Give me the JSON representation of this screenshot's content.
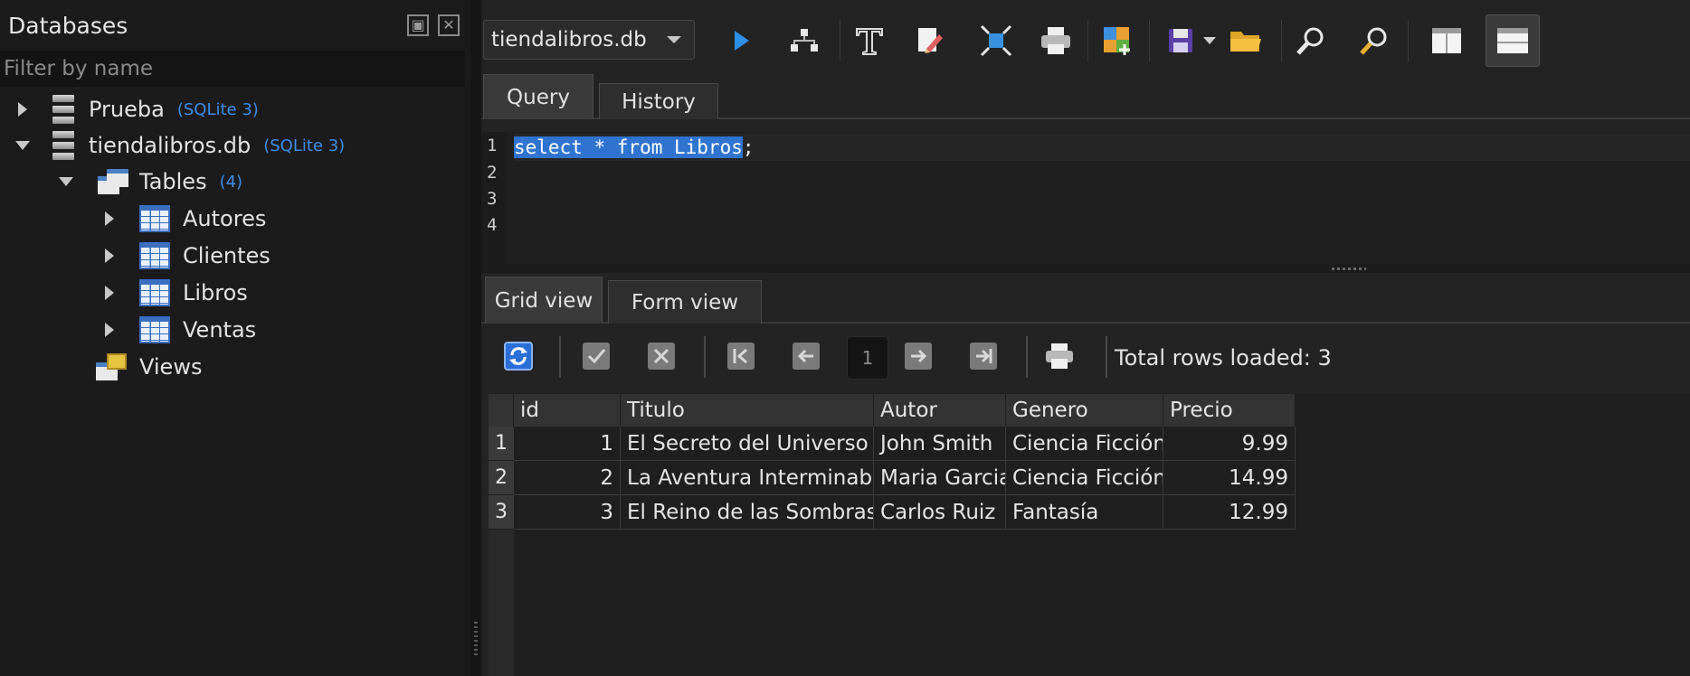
{
  "databases_panel": {
    "title": "Databases",
    "filter_placeholder": "Filter by name",
    "tree": {
      "prueba": {
        "label": "Prueba",
        "meta": "(SQLite 3)"
      },
      "tiendalibros": {
        "label": "tiendalibros.db",
        "meta": "(SQLite 3)"
      },
      "tables": {
        "label": "Tables",
        "count": "(4)"
      },
      "table_items": [
        "Autores",
        "Clientes",
        "Libros",
        "Ventas"
      ],
      "views": {
        "label": "Views"
      }
    }
  },
  "toolbar": {
    "db_selector": "tiendalibros.db",
    "icons": [
      "execute-icon",
      "explain-plan-icon",
      "format-text-icon",
      "clear-icon",
      "fit-icon",
      "print-icon",
      "import-icon",
      "save-icon",
      "save-dropdown-icon",
      "open-folder-icon",
      "zoom-in-icon",
      "zoom-out-icon",
      "layout-vertical-icon",
      "layout-horizontal-icon"
    ]
  },
  "query_tabs": {
    "query": "Query",
    "history": "History"
  },
  "editor": {
    "line_numbers": [
      "1",
      "2",
      "3",
      "4"
    ],
    "selected_sql": "select * from Libros",
    "trailing": ";"
  },
  "result_tabs": {
    "grid": "Grid view",
    "form": "Form view"
  },
  "result_toolbar": {
    "page": "1",
    "total_rows": "Total rows loaded: 3"
  },
  "grid": {
    "columns": [
      "id",
      "Titulo",
      "Autor",
      "Genero",
      "Precio"
    ],
    "rows": [
      {
        "n": "1",
        "id": "1",
        "titulo": "El Secreto del Universo",
        "autor": "John Smith",
        "genero": "Ciencia Ficción",
        "precio": "9.99"
      },
      {
        "n": "2",
        "id": "2",
        "titulo": "La Aventura Interminable",
        "autor": "Maria Garcia",
        "genero": "Ciencia Ficción",
        "precio": "14.99"
      },
      {
        "n": "3",
        "id": "3",
        "titulo": "El Reino de las Sombras",
        "autor": "Carlos Ruiz",
        "genero": "Fantasía",
        "precio": "12.99"
      }
    ]
  },
  "colors": {
    "accent_blue": "#3d8ee8",
    "selection": "#2f74d0",
    "panel_bg": "#1b1b1b"
  }
}
